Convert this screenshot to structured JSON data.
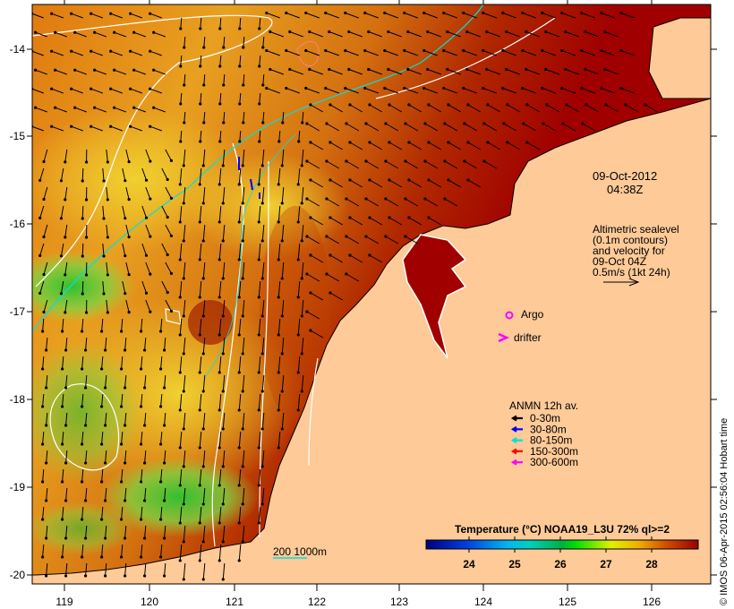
{
  "map": {
    "timestamp_date": "09-Oct-2012",
    "timestamp_time": "04:38Z",
    "altimetry_note": [
      "Altimetric sealevel",
      "(0.1m contours)",
      "and velocity for",
      "09-Oct 04Z",
      "0.5m/s (1kt 24h)"
    ],
    "argo_label": "Argo",
    "drifter_label": "drifter",
    "anmn_title": "ANMN 12h av.",
    "anmn_items": [
      {
        "label": "0-30m",
        "color": "#000000"
      },
      {
        "label": "30-80m",
        "color": "#0000ff"
      },
      {
        "label": "80-150m",
        "color": "#00e0e0"
      },
      {
        "label": "150-300m",
        "color": "#ff0000"
      },
      {
        "label": "300-600m",
        "color": "#ff00ff"
      }
    ],
    "scale_label": "200  1000m",
    "colorbar_title": "Temperature (°C) NOAA19_L3U 72% ql>=2",
    "colorbar_ticks": [
      "24",
      "25",
      "26",
      "27",
      "28"
    ],
    "lon_ticks": [
      "119",
      "120",
      "121",
      "122",
      "123",
      "124",
      "125",
      "126"
    ],
    "lat_ticks": [
      "-14",
      "-15",
      "-16",
      "-17",
      "-18",
      "-19",
      "-20"
    ],
    "credit": "© IMOS 06-Apr-2015 02:56:04 Hobart time",
    "colors": {
      "land": "#fdca98",
      "warm": "#a00000",
      "contour_200m": "#00e0e0"
    }
  }
}
